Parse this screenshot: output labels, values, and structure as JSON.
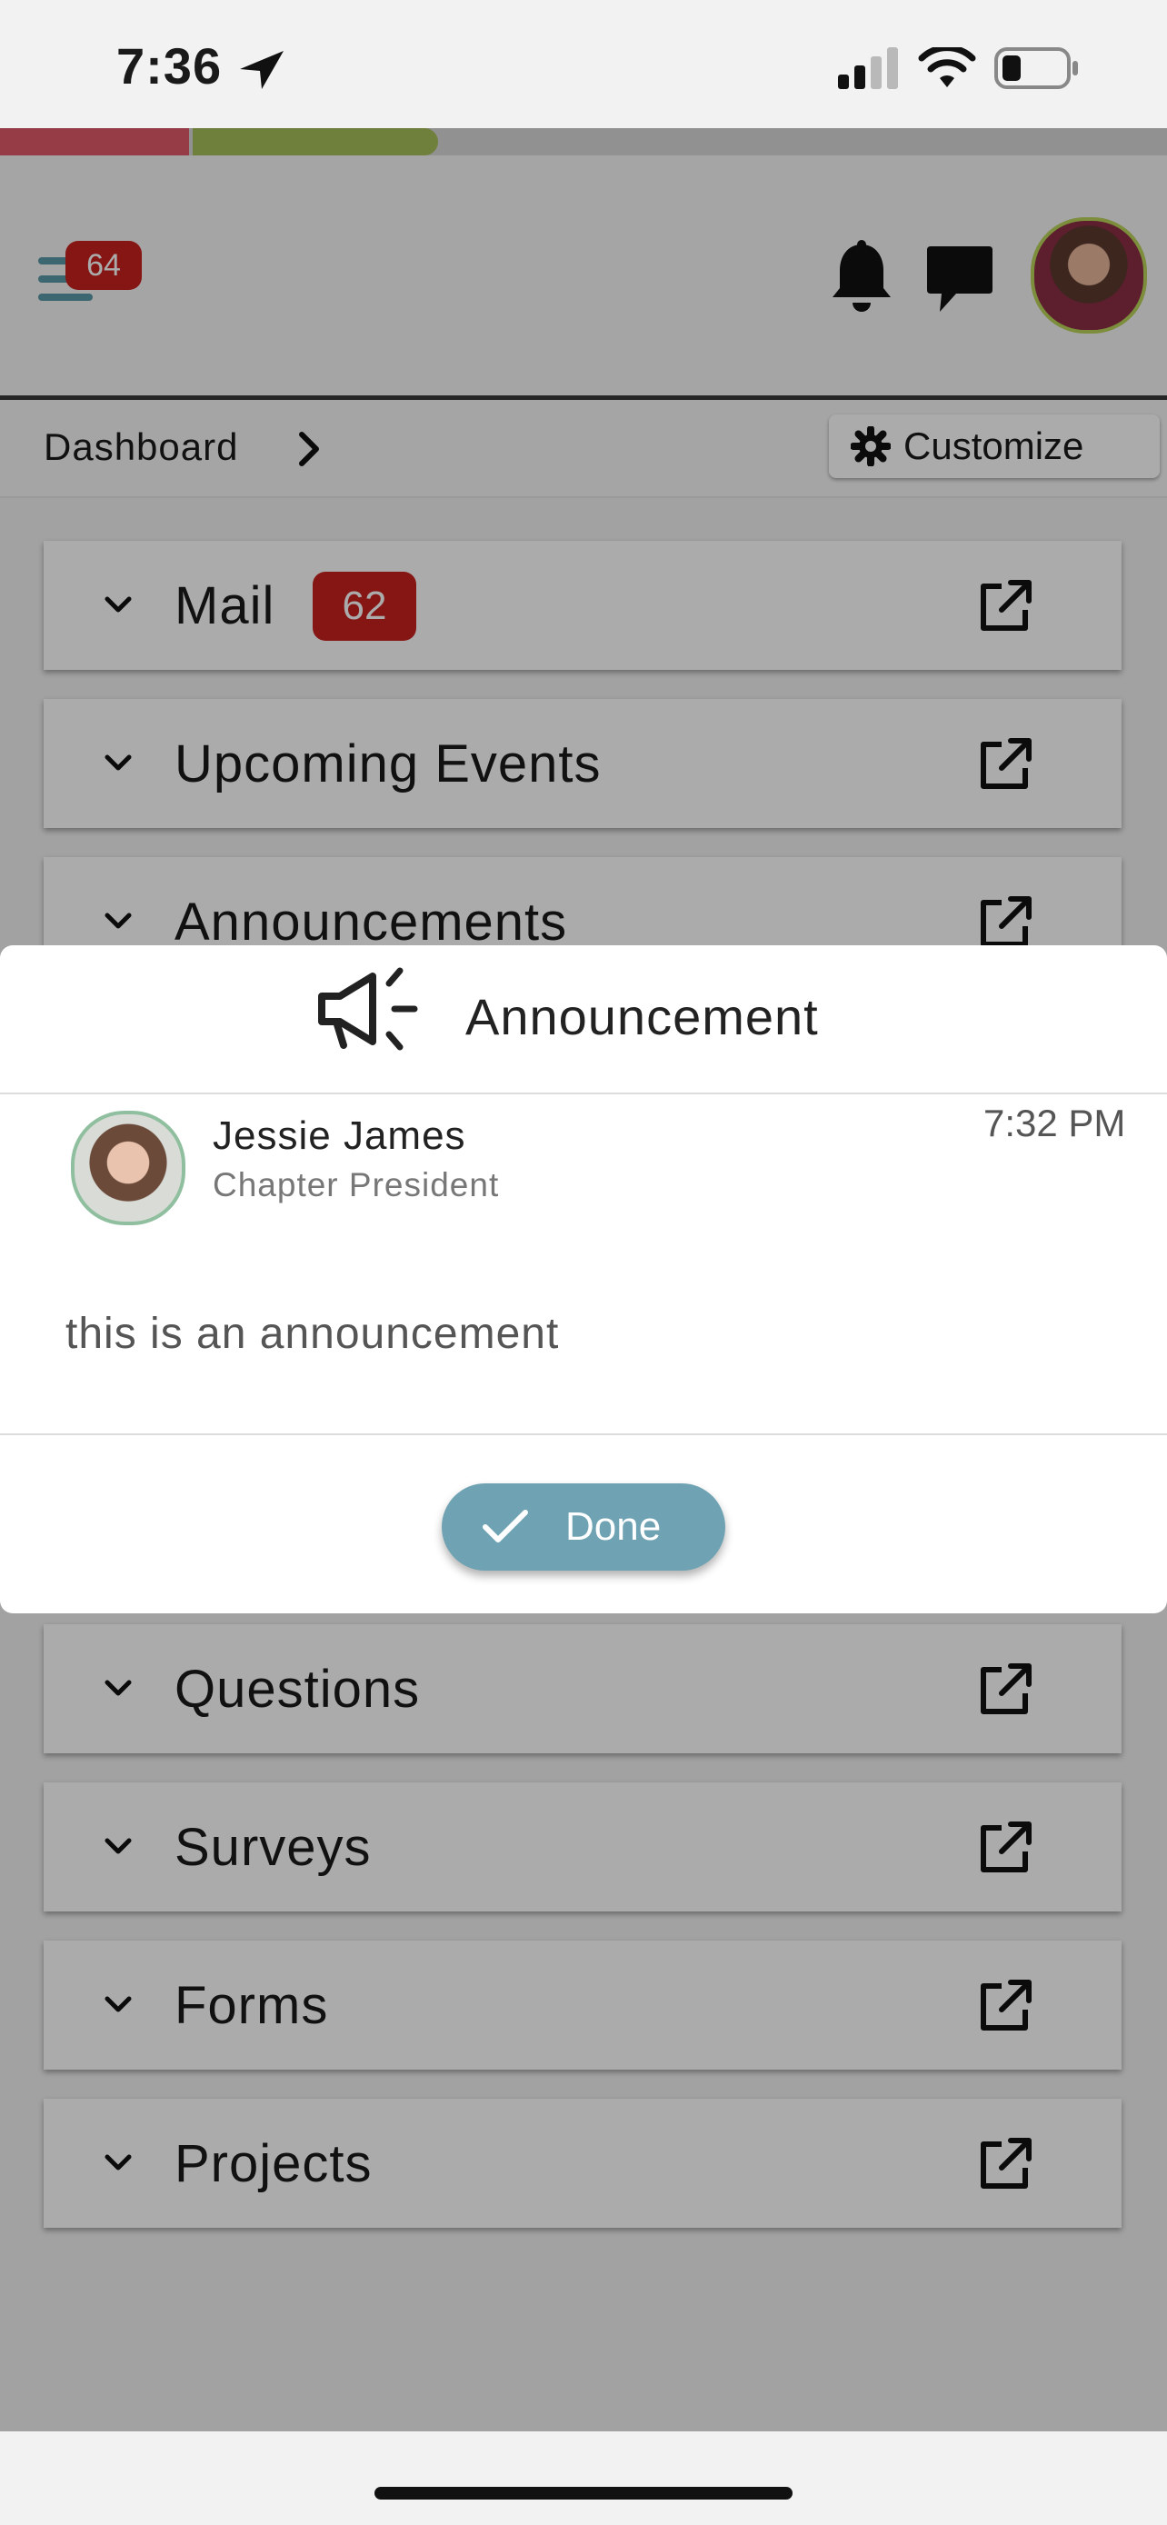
{
  "status_bar": {
    "time": "7:36"
  },
  "header": {
    "menu_badge": "64"
  },
  "progress": {
    "segments": [
      {
        "color": "#e05a6a",
        "fraction": 0.16
      },
      {
        "color": "#a6bf5a",
        "fraction": 0.21
      }
    ]
  },
  "breadcrumb": {
    "label": "Dashboard",
    "customize_label": "Customize"
  },
  "cards": {
    "mail": {
      "title": "Mail",
      "badge": "62"
    },
    "events": {
      "title": "Upcoming Events"
    },
    "announcements": {
      "title": "Announcements"
    },
    "questions": {
      "title": "Questions"
    },
    "surveys": {
      "title": "Surveys"
    },
    "forms": {
      "title": "Forms"
    },
    "projects": {
      "title": "Projects"
    }
  },
  "modal": {
    "title": "Announcement",
    "author": "Jessie James",
    "role": "Chapter President",
    "time": "7:32 PM",
    "message": "this is an announcement",
    "done_label": "Done"
  },
  "colors": {
    "accent": "#6fa3b3",
    "badge": "#c8211e"
  },
  "icons": [
    "location-arrow-icon",
    "signal-icon",
    "wifi-icon",
    "battery-icon",
    "menu-icon",
    "bell-icon",
    "chat-icon",
    "chevron-right-icon",
    "gear-icon",
    "chevron-down-icon",
    "external-link-icon",
    "megaphone-icon",
    "check-icon"
  ]
}
